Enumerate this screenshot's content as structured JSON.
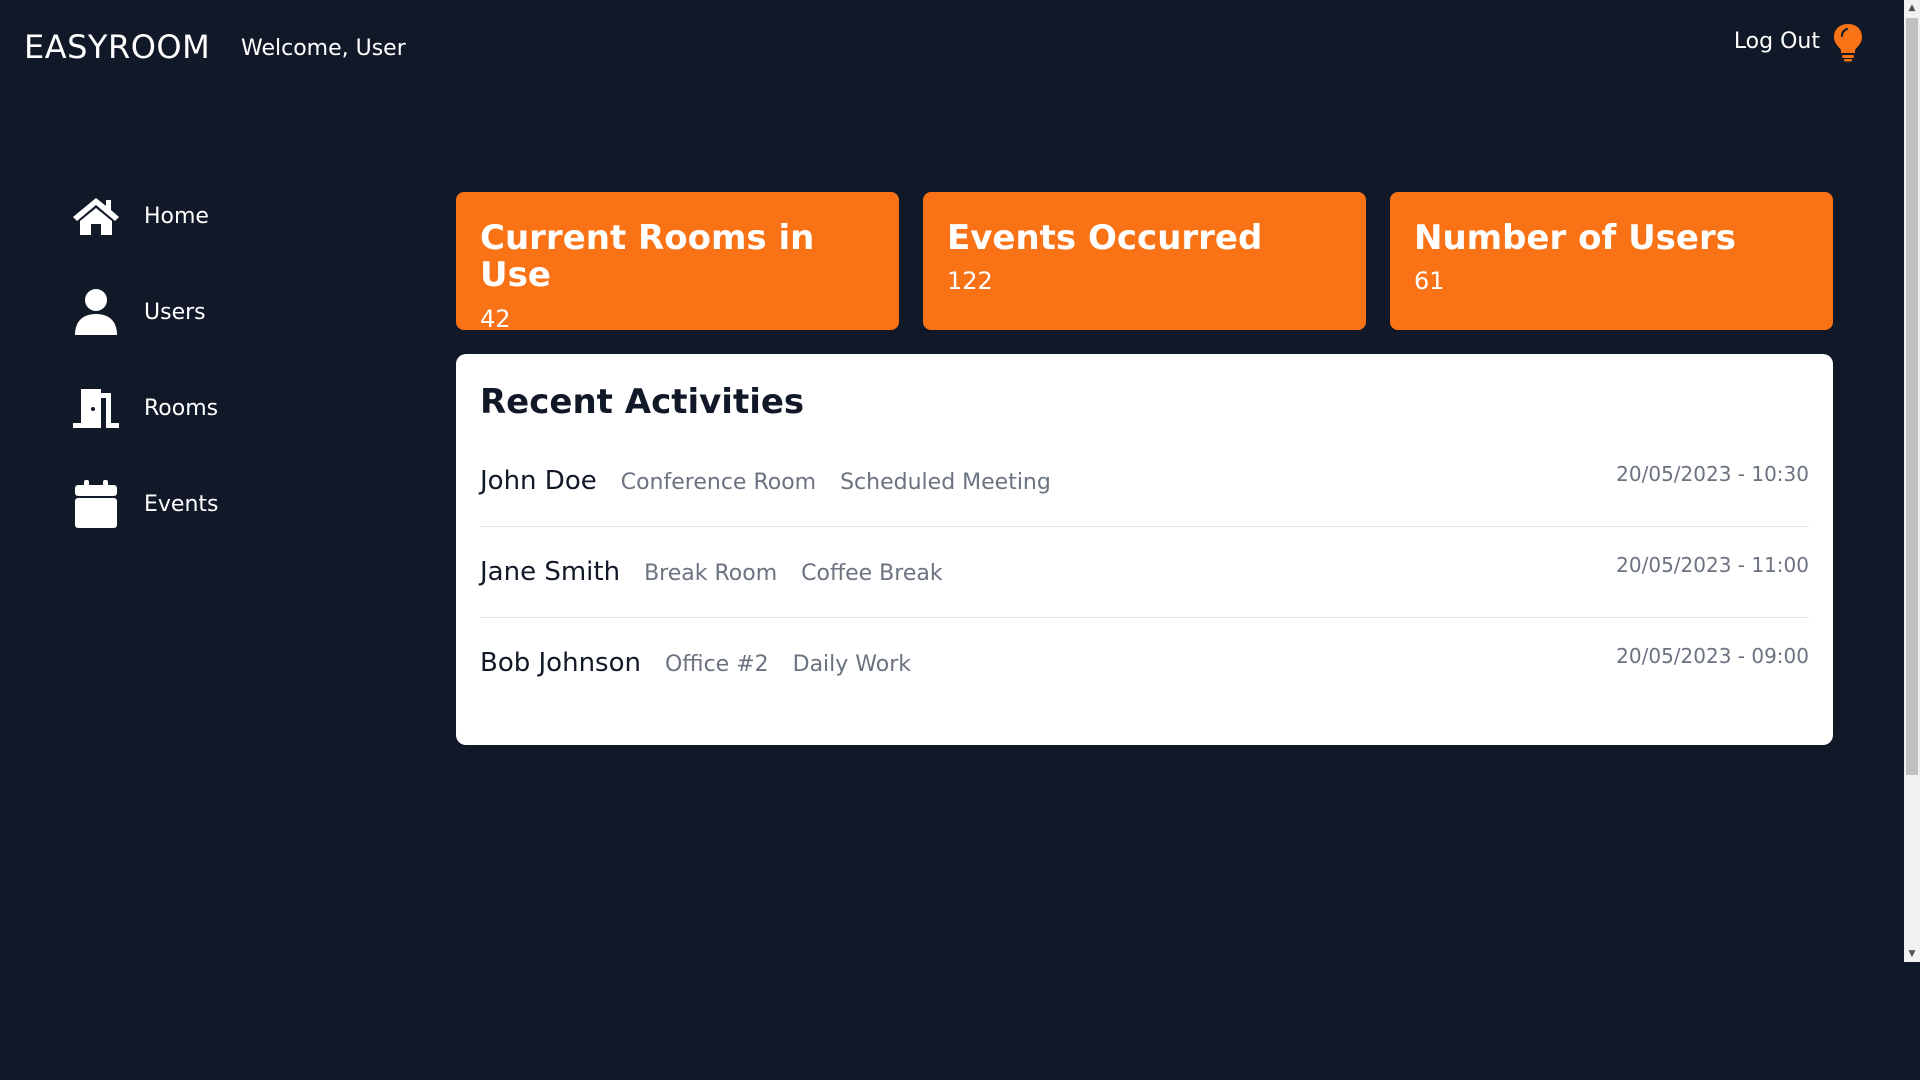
{
  "header": {
    "brand": "EASYROOM",
    "welcome": "Welcome, User",
    "logout_label": "Log Out",
    "theme_icon": "lightbulb-icon"
  },
  "sidebar": {
    "items": [
      {
        "label": "Home",
        "icon": "home-icon"
      },
      {
        "label": "Users",
        "icon": "user-icon"
      },
      {
        "label": "Rooms",
        "icon": "door-icon"
      },
      {
        "label": "Events",
        "icon": "calendar-icon"
      }
    ]
  },
  "stats": [
    {
      "title": "Current Rooms in Use",
      "value": "42"
    },
    {
      "title": "Events Occurred",
      "value": "122"
    },
    {
      "title": "Number of Users",
      "value": "61"
    }
  ],
  "activities": {
    "title": "Recent Activities",
    "rows": [
      {
        "name": "John Doe",
        "room": "Conference Room",
        "type": "Scheduled Meeting",
        "time": "20/05/2023 - 10:30"
      },
      {
        "name": "Jane Smith",
        "room": "Break Room",
        "type": "Coffee Break",
        "time": "20/05/2023 - 11:00"
      },
      {
        "name": "Bob Johnson",
        "room": "Office #2",
        "type": "Daily Work",
        "time": "20/05/2023 - 09:00"
      }
    ]
  },
  "colors": {
    "background": "#111827",
    "accent": "#f97316",
    "panel": "#ffffff",
    "muted_text": "#6b7280"
  }
}
